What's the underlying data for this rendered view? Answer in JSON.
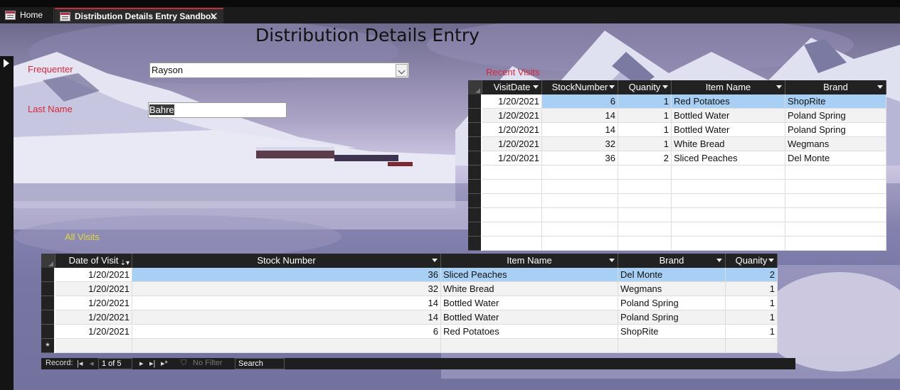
{
  "tabs": [
    {
      "label": "Home",
      "icon": "form-icon"
    },
    {
      "label": "Distribution Details Entry Sandbox",
      "icon": "form-icon"
    }
  ],
  "form": {
    "title": "Distribution Details Entry",
    "frequenter_label": "Frequenter",
    "frequenter_value": "Rayson",
    "lastname_label": "Last Name",
    "lastname_value": "Bahre",
    "recent_label": "Recent Visits",
    "all_label": "All Visits"
  },
  "recent": {
    "columns": [
      "VisitDate",
      "StockNumber",
      "Quanity",
      "Item Name",
      "Brand"
    ],
    "rows": [
      [
        "1/20/2021",
        "6",
        "1",
        "Red Potatoes",
        "ShopRite"
      ],
      [
        "1/20/2021",
        "14",
        "1",
        "Bottled Water",
        "Poland Spring"
      ],
      [
        "1/20/2021",
        "14",
        "1",
        "Bottled Water",
        "Poland Spring"
      ],
      [
        "1/20/2021",
        "32",
        "1",
        "White Bread",
        "Wegmans"
      ],
      [
        "1/20/2021",
        "36",
        "2",
        "Sliced Peaches",
        "Del Monte"
      ]
    ]
  },
  "all": {
    "columns": [
      "Date of Visit",
      "Stock Number",
      "Item Name",
      "Brand",
      "Quanity"
    ],
    "rows": [
      [
        "1/20/2021",
        "36",
        "Sliced Peaches",
        "Del Monte",
        "2"
      ],
      [
        "1/20/2021",
        "32",
        "White Bread",
        "Wegmans",
        "1"
      ],
      [
        "1/20/2021",
        "14",
        "Bottled Water",
        "Poland Spring",
        "1"
      ],
      [
        "1/20/2021",
        "14",
        "Bottled Water",
        "Poland Spring",
        "1"
      ],
      [
        "1/20/2021",
        "6",
        "Red Potatoes",
        "ShopRite",
        "1"
      ]
    ],
    "new_row_marker": "*"
  },
  "navigator": {
    "record_label": "Record:",
    "position": "1 of 5",
    "filter": "No Filter",
    "search": "Search"
  },
  "colors": {
    "label_red": "#d9283a",
    "label_yellow": "#e0d83a",
    "selection": "#a8d0f4",
    "tab_accent": "#c1303f"
  }
}
